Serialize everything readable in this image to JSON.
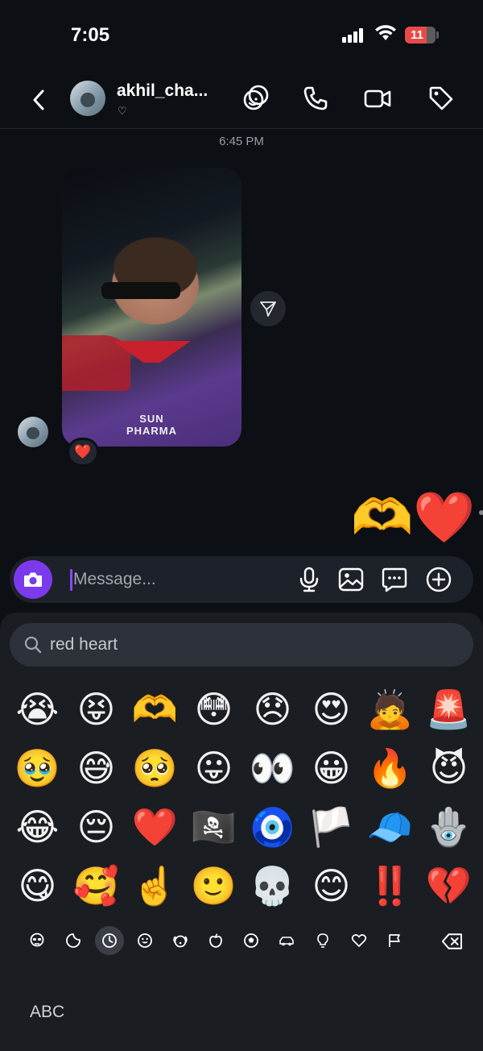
{
  "status_bar": {
    "time": "7:05",
    "battery": "11"
  },
  "header": {
    "username": "akhil_cha...",
    "status_heart": "♡"
  },
  "chat": {
    "timestamp": "6:45 PM",
    "photo_caption_text": "SUN PHARMA",
    "reaction": "❤️",
    "sent_emojis": [
      "🫶",
      "❤️"
    ]
  },
  "composer": {
    "placeholder": "Message..."
  },
  "keyboard": {
    "search_value": "red heart",
    "emoji_rows": [
      [
        "😭",
        "😝",
        "🫶",
        "😳",
        "😞",
        "😍",
        "🙇",
        "🚨"
      ],
      [
        "🥹",
        "😅",
        "🥺",
        "😛",
        "👀",
        "😀",
        "🔥",
        "😈"
      ],
      [
        "😂",
        "😔",
        "❤️",
        "🏴‍☠️",
        "🧿",
        "🏳️",
        "🧢",
        "🪬"
      ],
      [
        "😋",
        "🥰",
        "☝️",
        "🙂",
        "💀",
        "😊",
        "‼️",
        "💔"
      ]
    ],
    "abc_label": "ABC"
  },
  "colors": {
    "accent": "#7c3aed",
    "background": "#0c0f14",
    "keyboard_bg": "#1a1d22"
  }
}
